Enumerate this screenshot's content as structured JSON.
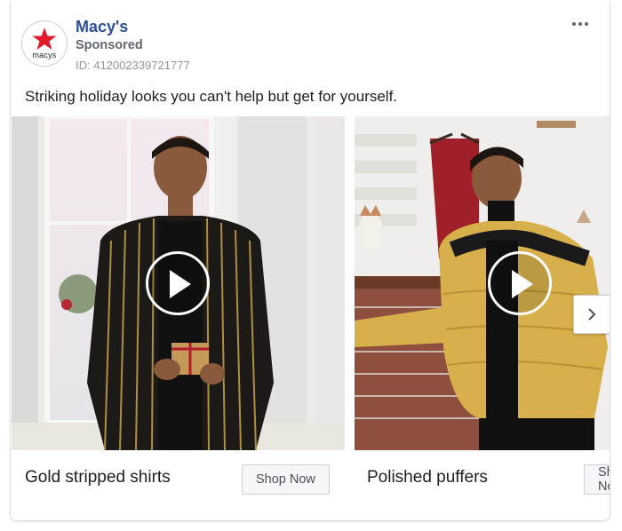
{
  "header": {
    "page_name": "Macy's",
    "sponsored_label": "Sponsored",
    "ad_id": "ID: 412002339721777",
    "logo_text": "macys"
  },
  "post": {
    "text": "Striking holiday looks you can't help but get for yourself."
  },
  "carousel": {
    "items": [
      {
        "title": "Gold stripped shirts",
        "cta": "Shop Now"
      },
      {
        "title": "Polished puffers",
        "cta": "Shop Now"
      }
    ]
  },
  "colors": {
    "brand_red": "#e21a2c",
    "link_blue": "#2b4c96"
  },
  "icons": {
    "logo": "macys-star-logo",
    "more": "more-options-icon",
    "play": "play-icon",
    "next": "chevron-right-icon"
  }
}
